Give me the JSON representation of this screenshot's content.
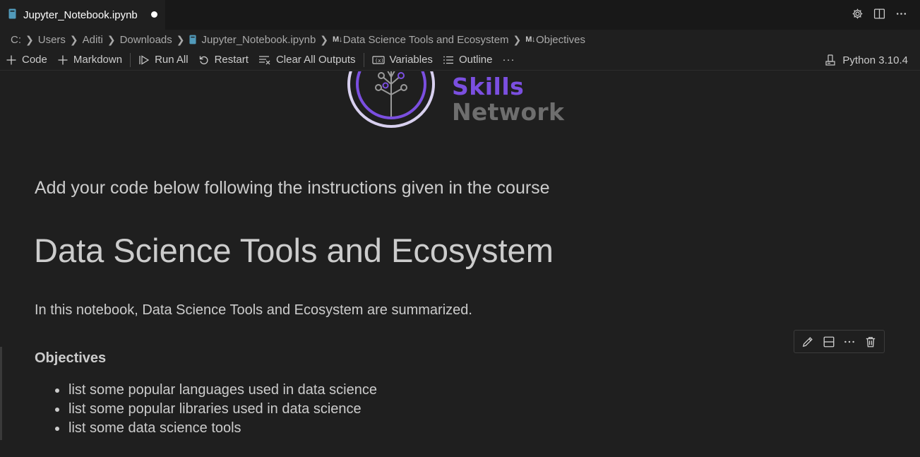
{
  "tab": {
    "title": "Jupyter_Notebook.ipynb",
    "icon": "notebook-icon"
  },
  "window_actions": [
    "gear-icon",
    "split-editor-icon",
    "more-icon"
  ],
  "breadcrumb": {
    "items": [
      "C:",
      "Users",
      "Aditi",
      "Downloads",
      "Jupyter_Notebook.ipynb",
      "Data Science Tools and Ecosystem",
      "Objectives"
    ],
    "md_tag": "M↓"
  },
  "toolbar": {
    "code": "Code",
    "markdown": "Markdown",
    "run_all": "Run All",
    "restart": "Restart",
    "clear_all_outputs": "Clear All Outputs",
    "variables": "Variables",
    "outline": "Outline",
    "more": "···",
    "kernel": "Python 3.10.4"
  },
  "logo": {
    "line1": "Skills",
    "line2": "Network",
    "accent": "#7b4fe0"
  },
  "content": {
    "instructions": "Add your code below following the instructions given in the course",
    "heading": "Data Science Tools and Ecosystem",
    "summary": "In this notebook, Data Science Tools and Ecosystem are summarized.",
    "objectives_title": "Objectives",
    "objectives": [
      "list some popular languages used in data science",
      "list some popular libraries used in data science",
      "list some data science tools"
    ]
  },
  "cell_toolbar": [
    "pencil-icon",
    "split-cell-icon",
    "more-icon",
    "trash-icon"
  ]
}
